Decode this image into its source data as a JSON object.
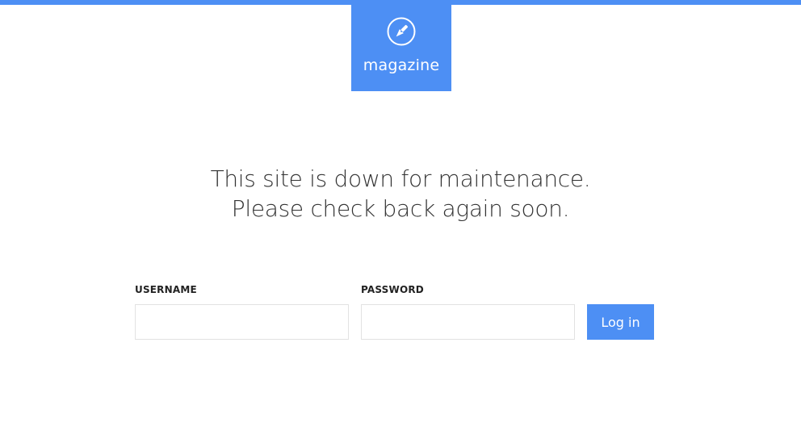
{
  "brand": {
    "name": "magazine",
    "icon": "pen-nib-icon",
    "color": "#4d8ff4"
  },
  "message": {
    "line1": "This site is down for maintenance.",
    "line2": "Please check back again soon."
  },
  "login": {
    "username_label": "USERNAME",
    "username_value": "",
    "password_label": "PASSWORD",
    "password_value": "",
    "submit_label": "Log in"
  }
}
